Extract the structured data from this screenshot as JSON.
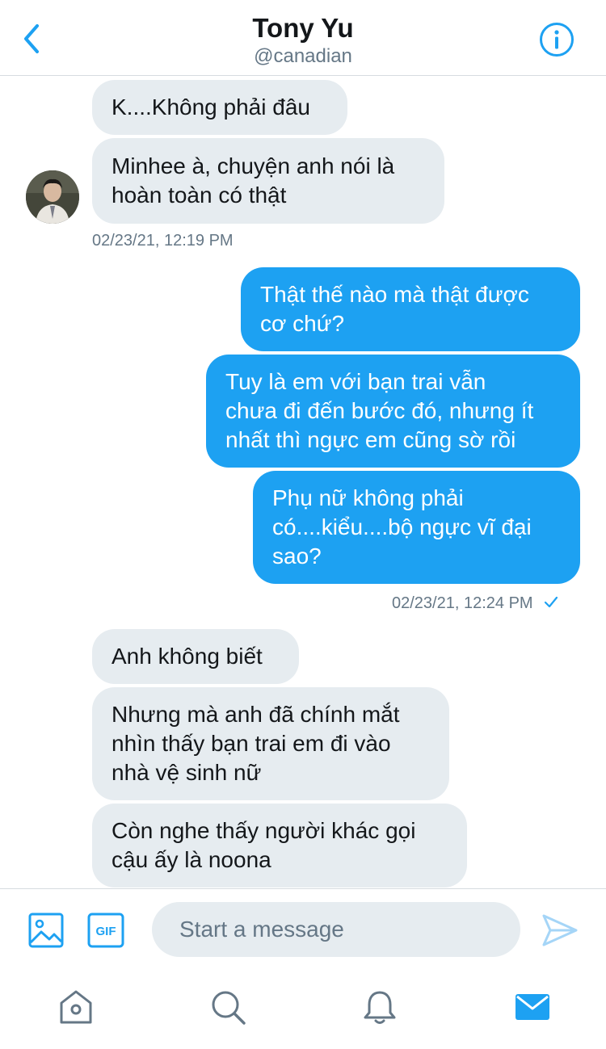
{
  "header": {
    "name": "Tony Yu",
    "handle": "@canadian",
    "icons": {
      "back": "chevron-left-icon",
      "info": "info-icon"
    }
  },
  "messages": [
    {
      "from": "them",
      "text": "K....Không phải đâu"
    },
    {
      "from": "them",
      "text": "Minhee à, chuyện anh nói là\nhoàn toàn có thật"
    },
    {
      "from": "meta",
      "text": "02/23/21, 12:19 PM"
    },
    {
      "from": "me",
      "text": "Thật thế nào mà thật được\ncơ chứ?"
    },
    {
      "from": "me",
      "text": "Tuy là em với bạn trai vẫn\nchưa đi đến bước đó, nhưng ít\nnhất thì ngực em cũng sờ rồi"
    },
    {
      "from": "me",
      "text": "Phụ nữ không phải\ncó....kiểu....bộ ngực vĩ đại\nsao?"
    },
    {
      "from": "meta",
      "text": "02/23/21, 12:24 PM"
    },
    {
      "from": "them",
      "text": "Anh không biết"
    },
    {
      "from": "them",
      "text": "Nhưng mà anh đã chính mắt\nnhìn thấy bạn trai em đi vào\nnhà vệ sinh nữ"
    },
    {
      "from": "them",
      "text": "Còn nghe thấy người khác gọi\ncậu ấy là noona"
    }
  ],
  "composer": {
    "placeholder": "Start a message",
    "value": "",
    "gif_label": "GIF",
    "icons": {
      "media": "image-icon",
      "gif": "gif-icon",
      "send": "send-icon"
    }
  },
  "tabbar": [
    {
      "name": "home",
      "icon": "home-icon",
      "active": false
    },
    {
      "name": "search",
      "icon": "search-icon",
      "active": false
    },
    {
      "name": "notifications",
      "icon": "bell-icon",
      "active": false
    },
    {
      "name": "messages",
      "icon": "mail-icon",
      "active": true
    }
  ],
  "colors": {
    "accent": "#1da1f2",
    "received_bubble": "#e6ecf0",
    "secondary_text": "#657786",
    "inactive_icon": "#657786"
  }
}
